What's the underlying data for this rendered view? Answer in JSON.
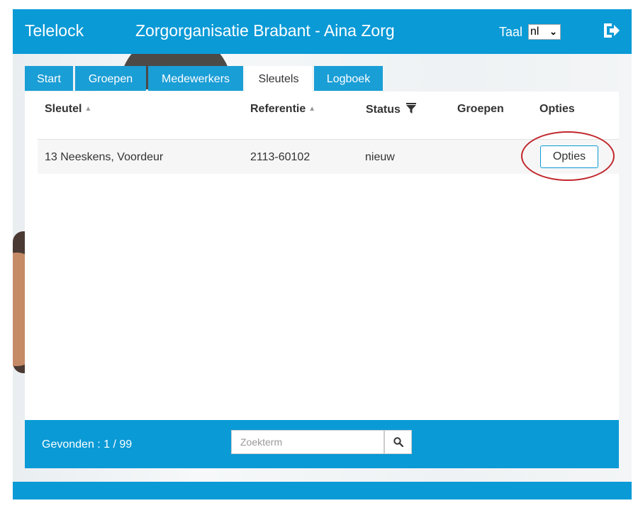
{
  "header": {
    "app_title": "Telelock",
    "organization": "Zorgorganisatie Brabant - Aina Zorg",
    "language_label": "Taal",
    "language_value": "nl"
  },
  "tabs": [
    {
      "label": "Start"
    },
    {
      "label": "Groepen"
    },
    {
      "label": "Medewerkers"
    },
    {
      "label": "Sleutels",
      "active": true
    },
    {
      "label": "Logboek"
    }
  ],
  "table": {
    "columns": [
      "Sleutel",
      "Referentie",
      "Status",
      "Groepen",
      "Opties"
    ],
    "rows": [
      {
        "sleutel": "13 Neeskens, Voordeur",
        "referentie": "2113-60102",
        "status": "nieuw",
        "groepen": "",
        "opties_label": "Opties"
      }
    ]
  },
  "footer": {
    "found_text": "Gevonden : 1 / 99",
    "search_placeholder": "Zoekterm"
  },
  "colors": {
    "brand": "#0a9ad6",
    "highlight": "#c1272d"
  },
  "icons": {
    "logout": "logout-icon",
    "search": "search-icon",
    "sort": "sort-up-icon",
    "filter": "filter-icon"
  }
}
